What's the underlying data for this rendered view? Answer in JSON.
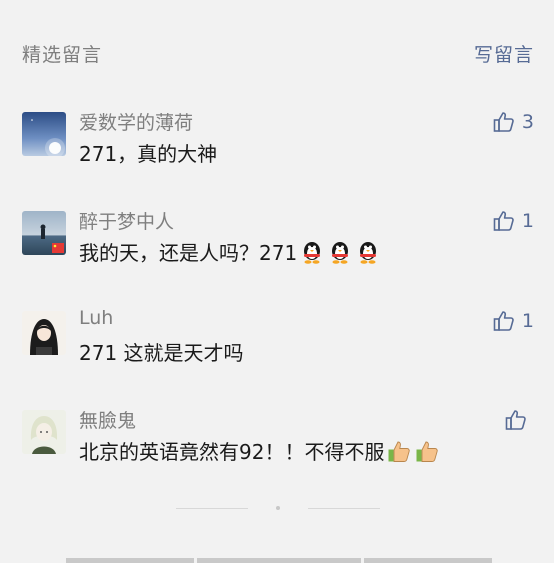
{
  "header": {
    "section_title": "精选留言",
    "write_label": "写留言"
  },
  "comments": [
    {
      "nickname": "爱数学的薄荷",
      "text": "271，真的大神",
      "likes": "3",
      "avatar": "night-sky-moon-avatar",
      "emojis": []
    },
    {
      "nickname": "醉于梦中人",
      "text": "我的天，还是人吗？271",
      "likes": "1",
      "avatar": "seaside-person-avatar",
      "emojis": [
        "qq-penguin-emoji",
        "qq-penguin-emoji",
        "qq-penguin-emoji"
      ]
    },
    {
      "nickname": "Luh",
      "text": "271 这就是天才吗",
      "likes": "1",
      "avatar": "anime-girl-avatar",
      "emojis": []
    },
    {
      "nickname": "無臉鬼",
      "text": "北京的英语竟然有92！！不得不服",
      "likes": "",
      "avatar": "anime-character-avatar",
      "emojis": [
        "thumbs-up-emoji",
        "thumbs-up-emoji"
      ]
    }
  ],
  "colors": {
    "link": "#576b95",
    "muted": "#7f7f7f",
    "background": "#f2f2f2"
  }
}
